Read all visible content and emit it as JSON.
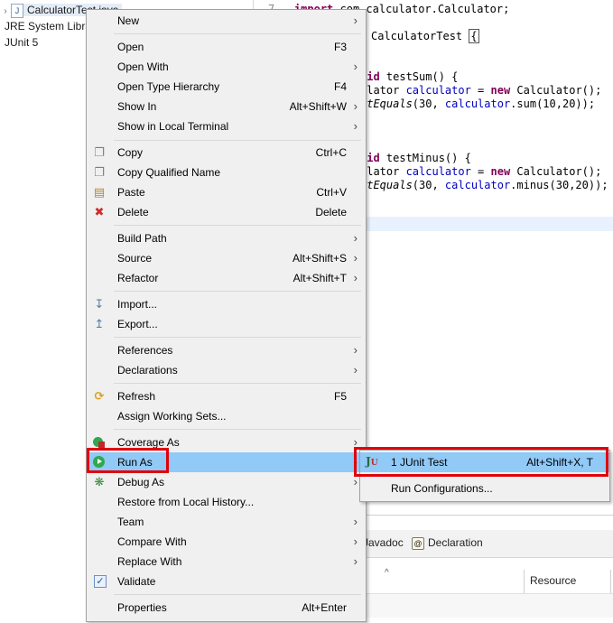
{
  "explorer": {
    "rows": [
      {
        "label": "CalculatorTest.java",
        "icon": "java-file-icon"
      },
      {
        "label": "JRE System Libra"
      },
      {
        "label": "JUnit 5"
      }
    ]
  },
  "editor": {
    "line1_num": "7",
    "line1_kw": "import",
    "line1_rest": " com.calculator.Calculator;",
    "class_name": "CalculatorTest",
    "brace": "{",
    "sum_sig_kw": "oid",
    "sum_sig_rest": " testSum() {",
    "sum_decl_type": "ulator ",
    "sum_decl_var": "calculator",
    "sum_decl_eq": " = ",
    "sum_decl_new": "new",
    "sum_decl_ctor": " Calculator();",
    "sum_assert_fn": "rtEquals",
    "sum_assert_args1": "(30, ",
    "sum_assert_var": "calculator",
    "sum_assert_args2": ".sum(10,20));",
    "minus_sig_kw": "oid",
    "minus_sig_rest": " testMinus() {",
    "minus_decl_type": "ulator ",
    "minus_decl_var": "calculator",
    "minus_decl_eq": " = ",
    "minus_decl_new": "new",
    "minus_decl_ctor": " Calculator();",
    "minus_assert_fn": "rtEquals",
    "minus_assert_args1": "(30, ",
    "minus_assert_var": "calculator",
    "minus_assert_args2": ".minus(30,20));"
  },
  "bottom_panel": {
    "tab_javadoc": "Javadoc",
    "tab_declaration": "Declaration",
    "col_resource": "Resource",
    "sort_caret": "^"
  },
  "context_menu": {
    "new": "New",
    "open": "Open",
    "open_sc": "F3",
    "open_with": "Open With",
    "open_type_hierarchy": "Open Type Hierarchy",
    "open_type_hierarchy_sc": "F4",
    "show_in": "Show In",
    "show_in_sc": "Alt+Shift+W",
    "show_in_terminal": "Show in Local Terminal",
    "copy": "Copy",
    "copy_sc": "Ctrl+C",
    "copy_qualified": "Copy Qualified Name",
    "paste": "Paste",
    "paste_sc": "Ctrl+V",
    "delete": "Delete",
    "delete_sc": "Delete",
    "build_path": "Build Path",
    "source": "Source",
    "source_sc": "Alt+Shift+S",
    "refactor": "Refactor",
    "refactor_sc": "Alt+Shift+T",
    "import": "Import...",
    "export": "Export...",
    "references": "References",
    "declarations": "Declarations",
    "refresh": "Refresh",
    "refresh_sc": "F5",
    "assign_working_sets": "Assign Working Sets...",
    "coverage_as": "Coverage As",
    "run_as": "Run As",
    "debug_as": "Debug As",
    "restore_history": "Restore from Local History...",
    "team": "Team",
    "compare_with": "Compare With",
    "replace_with": "Replace With",
    "validate": "Validate",
    "properties": "Properties",
    "properties_sc": "Alt+Enter",
    "arrow": "›"
  },
  "run_submenu": {
    "junit_test": "1 JUnit Test",
    "junit_test_sc": "Alt+Shift+X, T",
    "run_configurations": "Run Configurations..."
  },
  "colors": {
    "menu_bg": "#f0f0f0",
    "menu_highlight": "#91c9f7",
    "annotation_red": "#e0000b",
    "keyword": "#7f0055",
    "field": "#0000c0"
  }
}
